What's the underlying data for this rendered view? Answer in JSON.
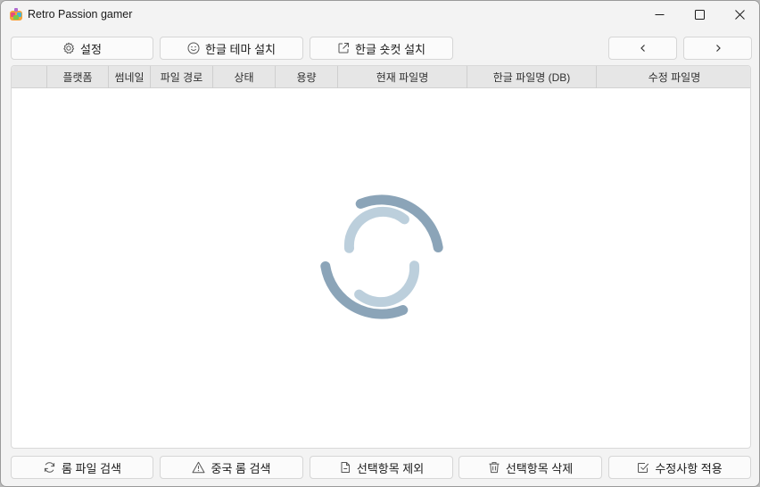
{
  "app": {
    "title": "Retro Passion gamer",
    "icon": "retro-passion-app-icon"
  },
  "window_controls": {
    "minimize": "minimize-icon",
    "maximize": "maximize-icon",
    "close": "close-icon"
  },
  "toolbar": {
    "settings_label": "설정",
    "theme_label": "한글 테마 설치",
    "shortcut_label": "한글 숏컷 설치",
    "prev_icon": "chevron-left-icon",
    "next_icon": "chevron-right-icon"
  },
  "table": {
    "columns": [
      "",
      "플랫폼",
      "썸네일",
      "파일 경로",
      "상태",
      "용량",
      "현재 파일명",
      "한글 파일명 (DB)",
      "수정 파일명"
    ],
    "rows": [],
    "loading": true
  },
  "footer": {
    "rom_search_label": "롬 파일 검색",
    "dup_search_label": "중국 롬 검색",
    "exclude_label": "선택항목 제외",
    "delete_label": "선택항목 삭제",
    "apply_label": "수정사항 적용"
  },
  "colors": {
    "spinner_dark": "#8ba4b8",
    "spinner_light": "#bccfdc",
    "header_bg": "#e6e6e6",
    "window_bg": "#f3f3f3"
  }
}
